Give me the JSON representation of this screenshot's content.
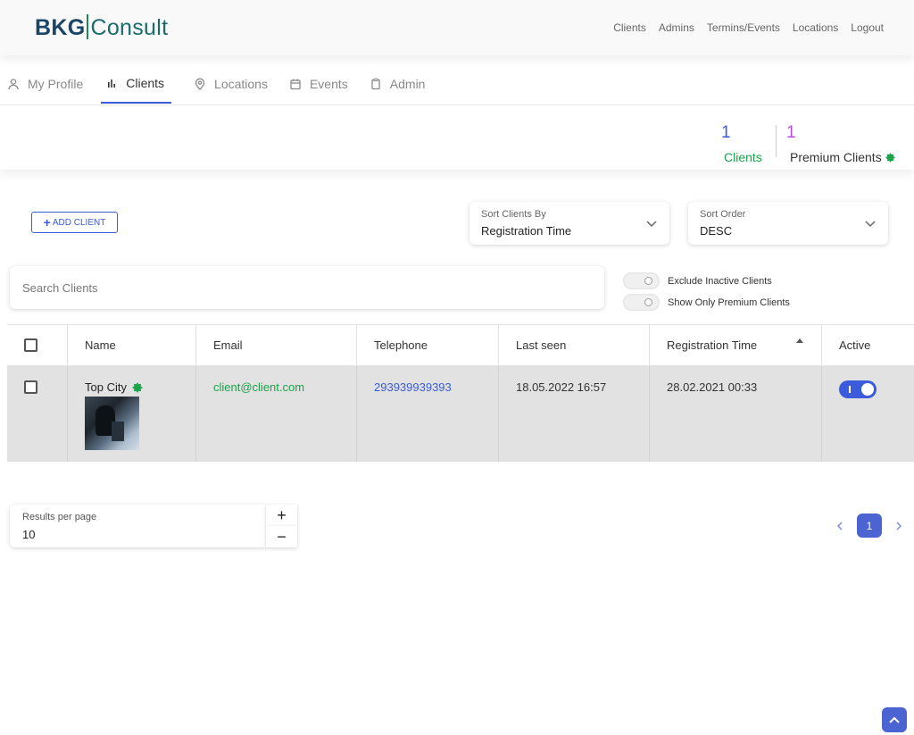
{
  "header": {
    "logo_left": "BKG",
    "logo_right": "Consult",
    "nav": [
      "Clients",
      "Admins",
      "Termins/Events",
      "Locations",
      "Logout"
    ]
  },
  "tabs": [
    {
      "label": "My Profile",
      "icon": "user-icon"
    },
    {
      "label": "Clients",
      "icon": "bar-chart-icon",
      "active": true
    },
    {
      "label": "Locations",
      "icon": "location-pin-icon"
    },
    {
      "label": "Events",
      "icon": "calendar-icon"
    },
    {
      "label": "Admin",
      "icon": "clipboard-icon"
    }
  ],
  "stats": {
    "clients_count": "1",
    "clients_label": "Clients",
    "premium_count": "1",
    "premium_label": "Premium Clients"
  },
  "toolbar": {
    "add_client_label": "ADD CLIENT",
    "sort_by_caption": "Sort Clients By",
    "sort_by_value": "Registration Time",
    "sort_order_caption": "Sort Order",
    "sort_order_value": "DESC"
  },
  "search": {
    "placeholder": "Search Clients",
    "value": ""
  },
  "filters": {
    "exclude_inactive_label": "Exclude Inactive Clients",
    "exclude_inactive_on": false,
    "premium_only_label": "Show Only Premium Clients",
    "premium_only_on": false
  },
  "table": {
    "columns": [
      "Name",
      "Email",
      "Telephone",
      "Last seen",
      "Registration Time",
      "Active"
    ],
    "sorted_column": "Registration Time",
    "rows": [
      {
        "name": "Top City",
        "premium": true,
        "email": "client@client.com",
        "telephone": "293939939393",
        "last_seen": "18.05.2022 16:57",
        "registration_time": "28.02.2021 00:33",
        "active": true
      }
    ]
  },
  "pagination": {
    "results_caption": "Results per page",
    "results_value": "10",
    "plus": "+",
    "minus": "−",
    "current_page": "1"
  },
  "colors": {
    "primary": "#3b5bdb",
    "green": "#1aa34a",
    "purple": "#b84be0"
  }
}
